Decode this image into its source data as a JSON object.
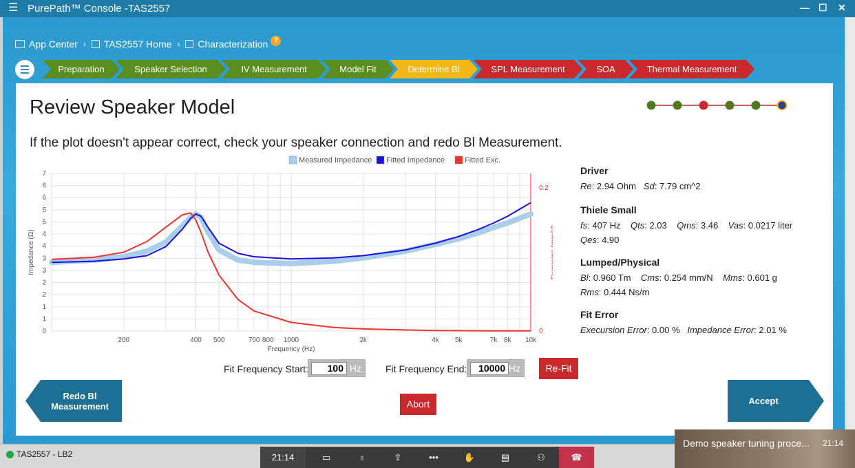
{
  "window": {
    "title": "PurePath™ Console -TAS2557",
    "minimize": "—",
    "maximize": "☐",
    "close": "✕"
  },
  "breadcrumb": [
    {
      "label": "App Center",
      "icon": "app-center-icon"
    },
    {
      "label": "TAS2557 Home",
      "icon": "chip-icon"
    },
    {
      "label": "Characterization",
      "icon": "chip-icon"
    }
  ],
  "help_label": "?",
  "steps": [
    {
      "label": "Preparation",
      "status": "done",
      "color": "#5a8f1f"
    },
    {
      "label": "Speaker Selection",
      "status": "done",
      "color": "#5a8f1f"
    },
    {
      "label": "IV Measurement",
      "status": "done",
      "color": "#5a8f1f"
    },
    {
      "label": "Model Fit",
      "status": "done",
      "color": "#5a8f1f"
    },
    {
      "label": "Determine Bl",
      "status": "current",
      "color": "#f3b716"
    },
    {
      "label": "SPL Measurement",
      "status": "todo",
      "color": "#c9282d"
    },
    {
      "label": "SOA",
      "status": "todo",
      "color": "#c9282d"
    },
    {
      "label": "Thermal Measurement",
      "status": "todo",
      "color": "#c9282d"
    }
  ],
  "page": {
    "title": "Review Speaker Model",
    "instruction": "If the plot doesn't appear correct, check your speaker connection and redo Bl Measurement."
  },
  "progress_dots": [
    "#4f7a22",
    "#4f7a22",
    "#c9282d",
    "#4f7a22",
    "#4f7a22",
    "#2f3f8f"
  ],
  "chart_data": {
    "type": "line",
    "legend": [
      "Measured Impedance",
      "Fitted Impedance",
      "Fitted Exc."
    ],
    "legend_colors": [
      "#a9cdea",
      "#1a0fe0",
      "#f0322a"
    ],
    "xlabel": "Frequency (Hz)",
    "ylabel": "Impedance (Ω)",
    "y2label": "Excursion (mm/V)",
    "xscale": "log",
    "xlim": [
      100,
      10000
    ],
    "ylim": [
      0,
      7
    ],
    "y2lim": [
      0,
      0.22
    ],
    "x_ticks": [
      200,
      400,
      500,
      700,
      800,
      1000,
      2000,
      4000,
      5000,
      7000,
      8000,
      10000
    ],
    "x_tick_labels": [
      "200",
      "400",
      "500",
      "700",
      "800",
      "1000",
      "2k",
      "4k",
      "5k",
      "7k",
      "8k",
      "10k"
    ],
    "y_tick_labels": [
      "0",
      "1",
      "1",
      "2",
      "2",
      "3",
      "3",
      "4",
      "4",
      "5",
      "5",
      "6",
      "6",
      "7"
    ],
    "y2_tick_labels": [
      "0",
      "0.2"
    ],
    "series": [
      {
        "name": "Measured Impedance",
        "x": [
          100,
          150,
          200,
          250,
          300,
          350,
          380,
          400,
          420,
          450,
          500,
          600,
          700,
          1000,
          1500,
          2000,
          3000,
          4000,
          5000,
          6000,
          7000,
          8000,
          10000
        ],
        "y": [
          3.05,
          3.15,
          3.3,
          3.55,
          3.95,
          4.65,
          5.05,
          5.2,
          5.05,
          4.4,
          3.6,
          3.15,
          3.05,
          3.0,
          3.1,
          3.25,
          3.55,
          3.85,
          4.1,
          4.35,
          4.6,
          4.8,
          5.2
        ]
      },
      {
        "name": "Fitted Impedance",
        "x": [
          100,
          150,
          200,
          250,
          300,
          350,
          380,
          400,
          420,
          450,
          500,
          600,
          700,
          1000,
          1500,
          2000,
          3000,
          4000,
          5000,
          6000,
          7000,
          8000,
          10000
        ],
        "y": [
          3.05,
          3.1,
          3.2,
          3.35,
          3.75,
          4.5,
          5.0,
          5.2,
          5.1,
          4.6,
          3.9,
          3.45,
          3.3,
          3.2,
          3.25,
          3.35,
          3.6,
          3.9,
          4.2,
          4.5,
          4.8,
          5.1,
          5.7
        ]
      },
      {
        "name": "Fitted Exc.",
        "axis": "y2",
        "x": [
          100,
          150,
          200,
          250,
          300,
          350,
          380,
          400,
          420,
          450,
          500,
          600,
          700,
          1000,
          1500,
          2000,
          3000,
          4000,
          5000,
          7000,
          10000
        ],
        "y": [
          0.1,
          0.103,
          0.11,
          0.125,
          0.145,
          0.162,
          0.165,
          0.155,
          0.138,
          0.11,
          0.078,
          0.044,
          0.028,
          0.012,
          0.005,
          0.003,
          0.0015,
          0.0008,
          0.0005,
          0.0003,
          0.0002
        ]
      }
    ]
  },
  "params": {
    "driver_title": "Driver",
    "re_label": "Re",
    "re_value": ": 2.94 Ohm",
    "sd_label": "Sd",
    "sd_value": ": 7.79 cm^2",
    "ts_title": "Thiele Small",
    "fs_label": "fs",
    "fs_value": ": 407 Hz",
    "qts_label": "Qts",
    "qts_value": ": 2.03",
    "qms_label": "Qms",
    "qms_value": ": 3.46",
    "vas_label": "Vas",
    "vas_value": ": 0.0217 liter",
    "qes_label": "Qes",
    "qes_value": ": 4.90",
    "lp_title": "Lumped/Physical",
    "bl_label": "Bl",
    "bl_value": ": 0.960 Tm",
    "cms_label": "Cms",
    "cms_value": ": 0.254 mm/N",
    "mms_label": "Mms",
    "mms_value": ": 0.601 g",
    "rms_label": "Rms",
    "rms_value": ": 0.444 Ns/m",
    "fe_title": "Fit Error",
    "exc_err_label": "Execursion Error",
    "exc_err_value": ": 0.00 %",
    "imp_err_label": "Impedance Error",
    "imp_err_value": ": 2.01 %"
  },
  "fit": {
    "start_label": "Fit Frequency Start:",
    "start_value": "100",
    "start_unit": "Hz",
    "end_label": "Fit Frequency End:",
    "end_value": "10000",
    "end_unit": "Hz",
    "refit_label": "Re-Fit"
  },
  "buttons": {
    "redo_line1": "Redo Bl",
    "redo_line2": "Measurement",
    "abort": "Abort",
    "accept": "Accept"
  },
  "status": {
    "device": "TAS2557 - LB2"
  },
  "call": {
    "time": "21:14"
  },
  "video": {
    "title": "Demo speaker tuning proce...",
    "time": "21:14"
  }
}
